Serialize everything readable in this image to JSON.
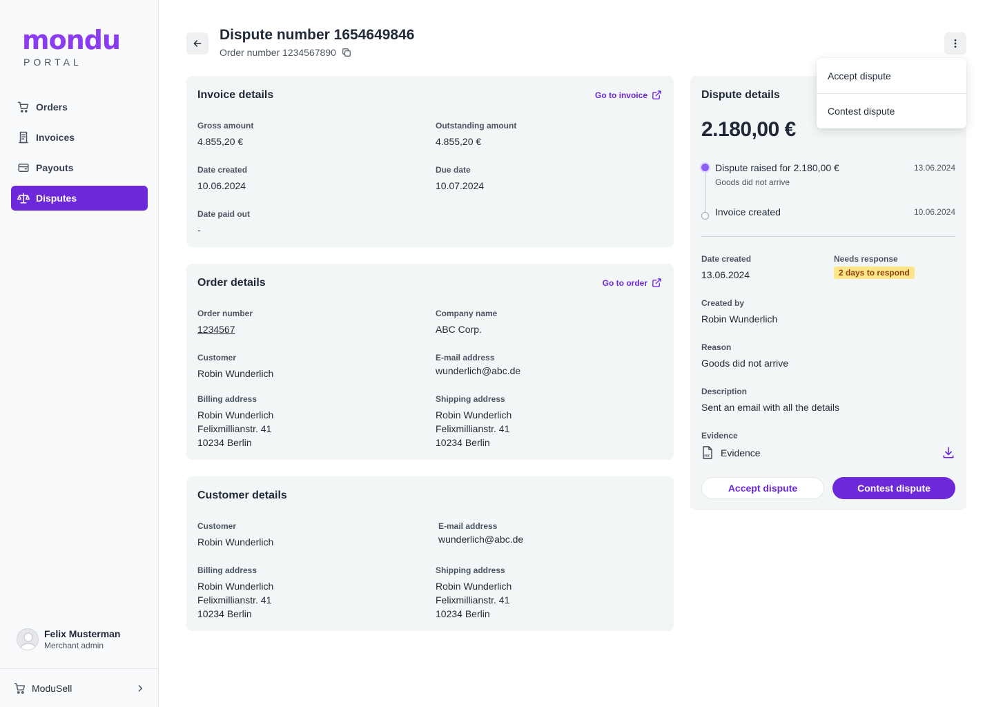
{
  "brand": {
    "name": "mondu",
    "subtitle": "PORTAL",
    "color": "#8b3cf0"
  },
  "sidebar": {
    "items": [
      {
        "label": "Orders",
        "icon": "cart-icon",
        "active": false
      },
      {
        "label": "Invoices",
        "icon": "invoice-icon",
        "active": false
      },
      {
        "label": "Payouts",
        "icon": "wallet-icon",
        "active": false
      },
      {
        "label": "Disputes",
        "icon": "scale-icon",
        "active": true
      }
    ],
    "user": {
      "name": "Felix Musterman",
      "role": "Merchant admin"
    },
    "footer": {
      "label": "ModuSell"
    }
  },
  "header": {
    "title": "Dispute number 1654649846",
    "subtitle": "Order number 1234567890"
  },
  "menu": {
    "items": [
      "Accept dispute",
      "Contest dispute"
    ]
  },
  "invoice": {
    "title": "Invoice details",
    "link": "Go to invoice",
    "gross_label": "Gross amount",
    "gross_value": "4.855,20 €",
    "outstanding_label": "Outstanding amount",
    "outstanding_value": "4.855,20 €",
    "created_label": "Date created",
    "created_value": "10.06.2024",
    "due_label": "Due date",
    "due_value": "10.07.2024",
    "paid_label": "Date paid out",
    "paid_value": "-"
  },
  "order": {
    "title": "Order details",
    "link": "Go to order",
    "number_label": "Order number",
    "number_value": "1234567",
    "company_label": "Company name",
    "company_value": "ABC Corp.",
    "customer_label": "Customer",
    "customer_value": "Robin Wunderlich",
    "email_label": "E-mail address",
    "email_value": "wunderlich@abc.de",
    "billing_label": "Billing address",
    "billing_lines": [
      "Robin Wunderlich",
      "Felixmillianstr. 41",
      "10234 Berlin"
    ],
    "shipping_label": "Shipping address",
    "shipping_lines": [
      "Robin Wunderlich",
      "Felixmillianstr. 41",
      "10234 Berlin"
    ]
  },
  "customer": {
    "title": "Customer details",
    "customer_label": "Customer",
    "customer_value": "Robin Wunderlich",
    "email_label": "E-mail address",
    "email_value": "wunderlich@abc.de",
    "billing_label": "Billing address",
    "billing_lines": [
      "Robin Wunderlich",
      "Felixmillianstr. 41",
      "10234 Berlin"
    ],
    "shipping_label": "Shipping address",
    "shipping_lines": [
      "Robin Wunderlich",
      "Felixmillianstr. 41",
      "10234 Berlin"
    ]
  },
  "dispute": {
    "title": "Dispute details",
    "amount": "2.180,00 €",
    "timeline": [
      {
        "title": "Dispute raised for 2.180,00 €",
        "subtitle": "Goods did not arrive",
        "date": "13.06.2024"
      },
      {
        "title": "Invoice created",
        "date": "10.06.2024"
      }
    ],
    "created_label": "Date created",
    "created_value": "13.06.2024",
    "needs_label": "Needs response",
    "needs_badge": "2 days to respond",
    "created_by_label": "Created by",
    "created_by_value": "Robin Wunderlich",
    "reason_label": "Reason",
    "reason_value": "Goods did not arrive",
    "description_label": "Description",
    "description_value": "Sent an email with all the details",
    "evidence_label": "Evidence",
    "evidence_file": "Evidence",
    "accept_button": "Accept dispute",
    "contest_button": "Contest dispute"
  },
  "colors": {
    "accent": "#6d28d9",
    "card_bg": "#f3f6f6",
    "badge_bg": "#fde68a"
  }
}
